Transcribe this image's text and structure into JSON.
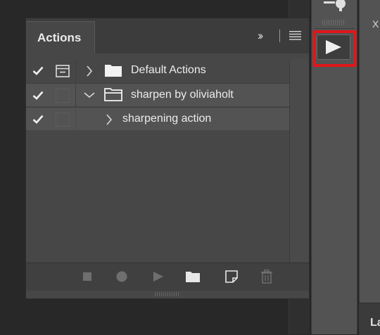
{
  "panel": {
    "tab_label": "Actions",
    "collapse_label": "››"
  },
  "actions": [
    {
      "label": "Default Actions",
      "checked": true,
      "dialog_toggle": true,
      "expanded": false,
      "icon": "folder-icon"
    },
    {
      "label": "sharpen by oliviaholt",
      "checked": true,
      "dialog_toggle": false,
      "expanded": true,
      "icon": "folder-open-icon"
    },
    {
      "label": "sharpening action",
      "checked": true,
      "dialog_toggle": false,
      "expanded": false,
      "icon": "none"
    }
  ],
  "footer": {
    "buttons": [
      "stop-icon",
      "record-icon",
      "play-icon",
      "new-set-icon",
      "new-action-icon",
      "trash-icon"
    ]
  },
  "dock": {
    "play_button": "play-icon",
    "highlight_color": "#e0161b"
  },
  "right_panel": {
    "top_text": "X",
    "bottom_text": "La"
  }
}
